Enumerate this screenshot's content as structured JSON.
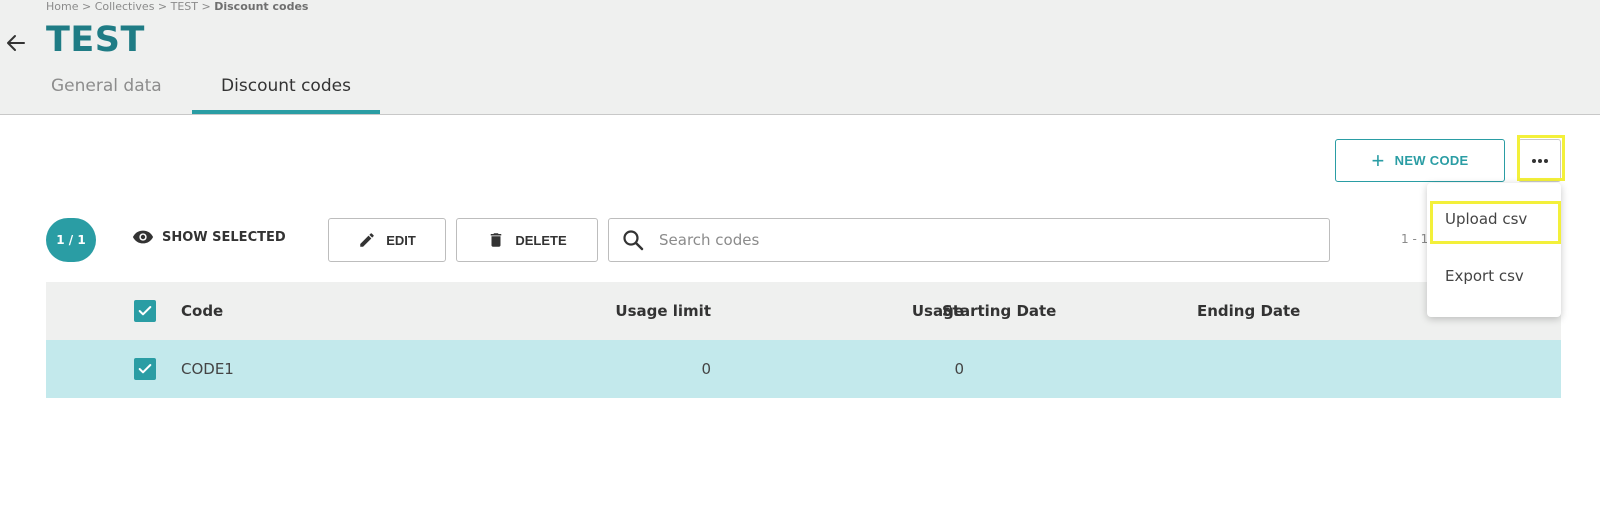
{
  "breadcrumb": {
    "items": [
      "Home",
      "Collectives",
      "TEST"
    ],
    "separator": ">",
    "current": "Discount codes"
  },
  "page": {
    "title": "TEST"
  },
  "tabs": [
    {
      "label": "General data",
      "active": false
    },
    {
      "label": "Discount codes",
      "active": true
    }
  ],
  "toolbar": {
    "new_code_label": "NEW CODE",
    "selection_badge": "1 / 1",
    "show_selected_label": "SHOW SELECTED",
    "edit_label": "EDIT",
    "delete_label": "DELETE",
    "search_placeholder": "Search codes",
    "search_value": "",
    "pagination_text": "1 - 1"
  },
  "menu": {
    "items": [
      {
        "label": "Upload csv",
        "highlighted": true
      },
      {
        "label": "Export csv",
        "highlighted": false
      }
    ]
  },
  "table": {
    "columns": [
      "Code",
      "Usage limit",
      "Usage",
      "Starting Date",
      "Ending Date"
    ],
    "rows": [
      {
        "selected": true,
        "code": "CODE1",
        "usage_limit": "0",
        "usage": "0",
        "starting_date": "",
        "ending_date": ""
      }
    ]
  },
  "icons": {
    "back": "arrow-left-icon",
    "add": "plus-icon",
    "more": "more-horizontal-icon",
    "show_selected": "eye-icon",
    "edit": "pencil-icon",
    "delete": "trash-icon",
    "search": "search-icon",
    "checkbox": "checkbox-checked-icon"
  },
  "colors": {
    "accent": "#2a9da4",
    "title": "#1f7c85",
    "header_bg": "#eff0ef",
    "selected_row": "#c3e9ec",
    "highlight": "#f3f03a"
  }
}
